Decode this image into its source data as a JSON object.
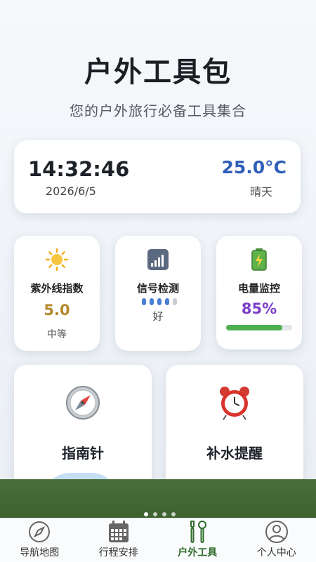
{
  "header": {
    "title": "户外工具包",
    "subtitle": "您的户外旅行必备工具集合"
  },
  "clock": {
    "time": "14:32:46",
    "date": "2026/6/5",
    "temperature": "25.0°C",
    "weather": "晴天"
  },
  "uv": {
    "label": "紫外线指数",
    "value": "5.0",
    "level": "中等",
    "icon": "sun-icon"
  },
  "signal": {
    "label": "信号检测",
    "quality": "好",
    "bars_on": 4,
    "bars_total": 5,
    "icon": "signal-icon"
  },
  "battery": {
    "label": "电量监控",
    "percent": "85%",
    "level_fraction": 0.85,
    "icon": "battery-icon"
  },
  "tools": [
    {
      "label": "指南针",
      "icon": "compass-icon"
    },
    {
      "label": "补水提醒",
      "icon": "alarm-clock-icon"
    }
  ],
  "tabbar": {
    "items": [
      {
        "label": "导航地图",
        "icon": "compass-icon"
      },
      {
        "label": "行程安排",
        "icon": "calendar-icon"
      },
      {
        "label": "户外工具",
        "icon": "tools-icon",
        "active": true
      },
      {
        "label": "个人中心",
        "icon": "user-icon"
      }
    ]
  },
  "colors": {
    "temperature": "#2f5fb8",
    "uv_value": "#b3892c",
    "battery_value": "#7b3ec9",
    "battery_bar": "#4caf50",
    "active_tab": "#2e6b2a",
    "band": "#4a6e3a"
  }
}
